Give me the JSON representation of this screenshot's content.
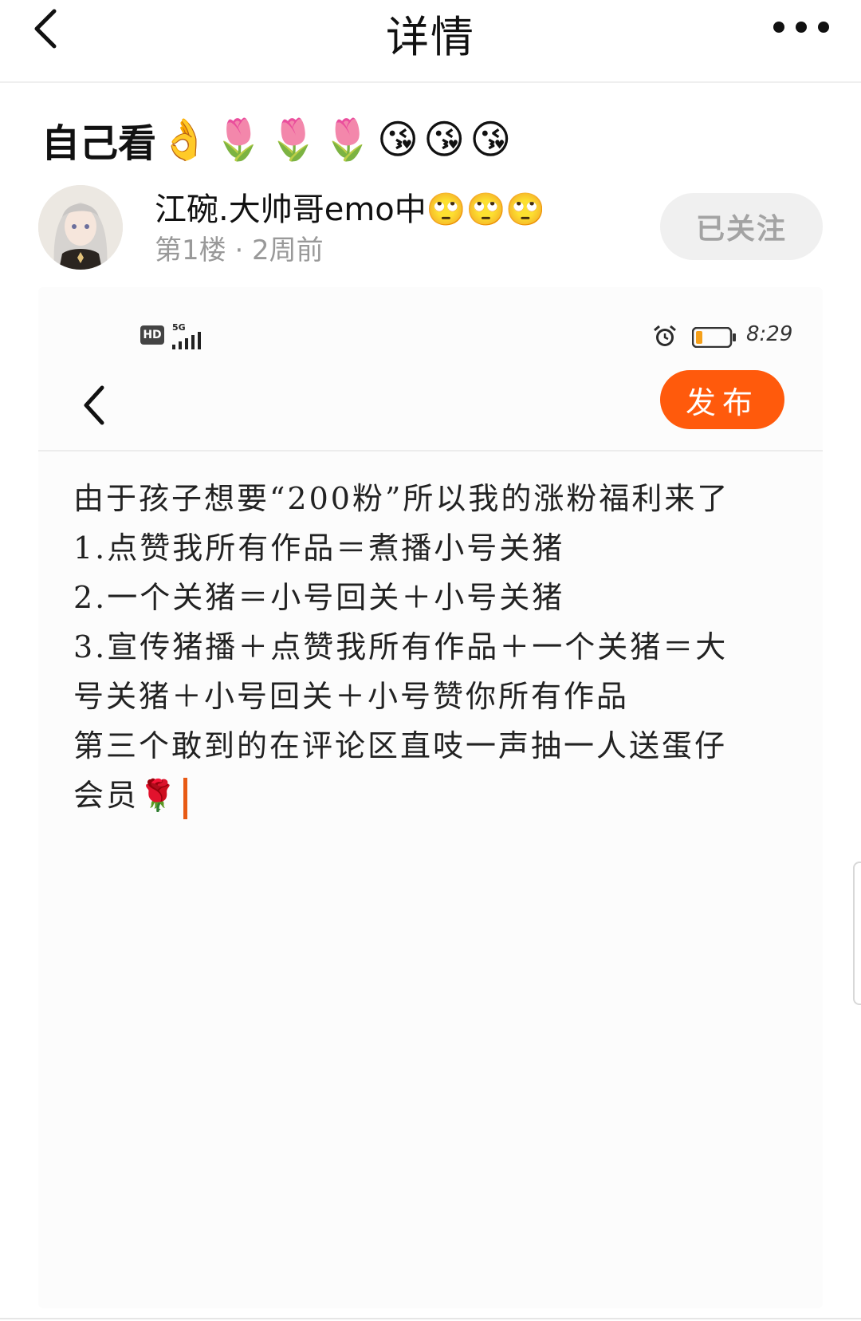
{
  "header": {
    "title": "详情",
    "back_icon": "chevron-left-icon",
    "more_icon": "more-horizontal-icon"
  },
  "post": {
    "title": "自己看",
    "title_emojis": "👌🌷🌷🌷😘😘😘",
    "author": {
      "name": "江碗.大帅哥emo中🙄🙄🙄",
      "meta": "第1楼 · 2周前",
      "follow_label": "已关注"
    }
  },
  "screenshot": {
    "status_bar": {
      "hd_label": "HD",
      "network_label": "5G",
      "time": "8:29"
    },
    "publish_label": "发布",
    "text_lines": [
      "由于孩子想要“200粉”所以我的涨粉福利来了",
      "1.点赞我所有作品＝煮播小号关猪",
      "2.一个关猪＝小号回关＋小号关猪",
      "3.宣传猪播＋点赞我所有作品＋一个关猪＝大",
      "号关猪＋小号回关＋小号赞你所有作品",
      "第三个敢到的在评论区直吱一声抽一人送蛋仔",
      "会员🌹"
    ]
  },
  "colors": {
    "accent": "#ff5a0c",
    "follow_bg": "#f0f0f0",
    "follow_text": "#a3a3a3",
    "meta_text": "#999999"
  }
}
